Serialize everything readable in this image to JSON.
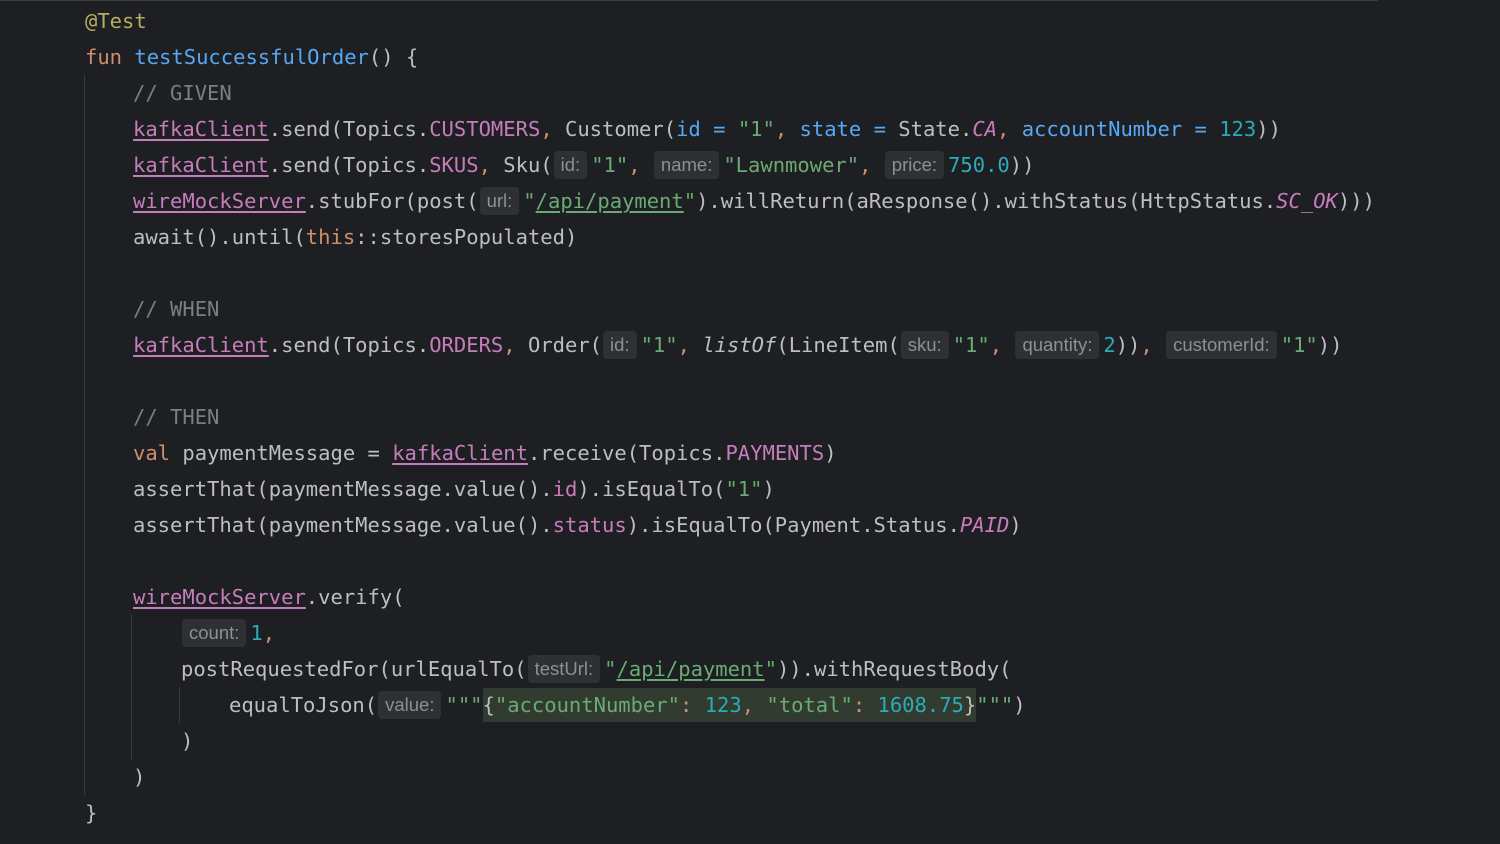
{
  "editor": {
    "lines": [
      {
        "indent": 0,
        "tokens": [
          {
            "t": "@Test",
            "c": "ann"
          }
        ]
      },
      {
        "indent": 0,
        "tokens": [
          {
            "t": "fun ",
            "c": "kw"
          },
          {
            "t": "testSuccessfulOrder",
            "c": "fn"
          },
          {
            "t": "() {",
            "c": ""
          }
        ]
      },
      {
        "indent": 1,
        "tokens": [
          {
            "t": "// GIVEN",
            "c": "cmt"
          }
        ]
      },
      {
        "indent": 1,
        "tokens": [
          {
            "t": "kafkaClient",
            "c": "prop ul"
          },
          {
            "t": ".send(Topics.",
            "c": ""
          },
          {
            "t": "CUSTOMERS",
            "c": "prop"
          },
          {
            "t": ", ",
            "c": "kw"
          },
          {
            "t": "Customer(",
            "c": ""
          },
          {
            "t": "id = ",
            "c": "named"
          },
          {
            "t": "\"1\"",
            "c": "str"
          },
          {
            "t": ", ",
            "c": "kw"
          },
          {
            "t": "state = ",
            "c": "named"
          },
          {
            "t": "State.",
            "c": ""
          },
          {
            "t": "CA",
            "c": "ital-prop"
          },
          {
            "t": ", ",
            "c": "kw"
          },
          {
            "t": "accountNumber = ",
            "c": "named"
          },
          {
            "t": "123",
            "c": "num"
          },
          {
            "t": "))",
            "c": ""
          }
        ]
      },
      {
        "indent": 1,
        "tokens": [
          {
            "t": "kafkaClient",
            "c": "prop ul"
          },
          {
            "t": ".send(Topics.",
            "c": ""
          },
          {
            "t": "SKUS",
            "c": "prop"
          },
          {
            "t": ", ",
            "c": "kw"
          },
          {
            "t": "Sku(",
            "c": ""
          },
          {
            "h": "id:"
          },
          {
            "t": "\"1\"",
            "c": "str"
          },
          {
            "t": ", ",
            "c": "kw"
          },
          {
            "h": "name:"
          },
          {
            "t": "\"Lawnmower\"",
            "c": "str"
          },
          {
            "t": ", ",
            "c": "kw"
          },
          {
            "h": "price:"
          },
          {
            "t": "750.0",
            "c": "num"
          },
          {
            "t": "))",
            "c": ""
          }
        ]
      },
      {
        "indent": 1,
        "tokens": [
          {
            "t": "wireMockServer",
            "c": "prop ul"
          },
          {
            "t": ".stubFor(post(",
            "c": ""
          },
          {
            "h": "url:"
          },
          {
            "t": "\"",
            "c": "str"
          },
          {
            "t": "/api/payment",
            "c": "str ul"
          },
          {
            "t": "\"",
            "c": "str"
          },
          {
            "t": ").willReturn(aResponse().withStatus(HttpStatus.",
            "c": ""
          },
          {
            "t": "SC_OK",
            "c": "ital-prop"
          },
          {
            "t": ")))",
            "c": ""
          }
        ]
      },
      {
        "indent": 1,
        "tokens": [
          {
            "t": "await().until(",
            "c": ""
          },
          {
            "t": "this",
            "c": "kw"
          },
          {
            "t": "::storesPopulated)",
            "c": ""
          }
        ]
      },
      {
        "indent": 1,
        "tokens": []
      },
      {
        "indent": 1,
        "tokens": [
          {
            "t": "// WHEN",
            "c": "cmt"
          }
        ]
      },
      {
        "indent": 1,
        "tokens": [
          {
            "t": "kafkaClient",
            "c": "prop ul"
          },
          {
            "t": ".send(Topics.",
            "c": ""
          },
          {
            "t": "ORDERS",
            "c": "prop"
          },
          {
            "t": ", ",
            "c": "kw"
          },
          {
            "t": "Order(",
            "c": ""
          },
          {
            "h": "id:"
          },
          {
            "t": "\"1\"",
            "c": "str"
          },
          {
            "t": ", ",
            "c": "kw"
          },
          {
            "t": "listOf",
            "c": "ital"
          },
          {
            "t": "(LineItem(",
            "c": ""
          },
          {
            "h": "sku:"
          },
          {
            "t": "\"1\"",
            "c": "str"
          },
          {
            "t": ", ",
            "c": "kw"
          },
          {
            "h": "quantity:"
          },
          {
            "t": "2",
            "c": "num"
          },
          {
            "t": "))",
            "c": ""
          },
          {
            "t": ", ",
            "c": "kw"
          },
          {
            "h": "customerId:"
          },
          {
            "t": "\"1\"",
            "c": "str"
          },
          {
            "t": "))",
            "c": ""
          }
        ]
      },
      {
        "indent": 1,
        "tokens": []
      },
      {
        "indent": 1,
        "tokens": [
          {
            "t": "// THEN",
            "c": "cmt"
          }
        ]
      },
      {
        "indent": 1,
        "tokens": [
          {
            "t": "val ",
            "c": "kw"
          },
          {
            "t": "paymentMessage = ",
            "c": ""
          },
          {
            "t": "kafkaClient",
            "c": "prop ul"
          },
          {
            "t": ".receive(Topics.",
            "c": ""
          },
          {
            "t": "PAYMENTS",
            "c": "prop"
          },
          {
            "t": ")",
            "c": ""
          }
        ]
      },
      {
        "indent": 1,
        "tokens": [
          {
            "t": "assertThat(paymentMessage.value().",
            "c": ""
          },
          {
            "t": "id",
            "c": "prop"
          },
          {
            "t": ").isEqualTo(",
            "c": ""
          },
          {
            "t": "\"1\"",
            "c": "str"
          },
          {
            "t": ")",
            "c": ""
          }
        ]
      },
      {
        "indent": 1,
        "tokens": [
          {
            "t": "assertThat(paymentMessage.value().",
            "c": ""
          },
          {
            "t": "status",
            "c": "prop"
          },
          {
            "t": ").isEqualTo(Payment.Status.",
            "c": ""
          },
          {
            "t": "PAID",
            "c": "ital-prop"
          },
          {
            "t": ")",
            "c": ""
          }
        ]
      },
      {
        "indent": 1,
        "tokens": []
      },
      {
        "indent": 1,
        "tokens": [
          {
            "t": "wireMockServer",
            "c": "prop ul"
          },
          {
            "t": ".verify(",
            "c": ""
          }
        ]
      },
      {
        "indent": 2,
        "tokens": [
          {
            "h": "count:"
          },
          {
            "t": "1",
            "c": "num"
          },
          {
            "t": ",",
            "c": "kw"
          }
        ]
      },
      {
        "indent": 2,
        "tokens": [
          {
            "t": "postRequestedFor(urlEqualTo(",
            "c": ""
          },
          {
            "h": "testUrl:"
          },
          {
            "t": "\"",
            "c": "str"
          },
          {
            "t": "/api/payment",
            "c": "str ul"
          },
          {
            "t": "\"",
            "c": "str"
          },
          {
            "t": ")).withRequestBody(",
            "c": ""
          }
        ]
      },
      {
        "indent": 3,
        "tokens": [
          {
            "t": "equalToJson(",
            "c": ""
          },
          {
            "h": "value:"
          },
          {
            "t": "\"\"\"",
            "c": "str"
          },
          {
            "inject": [
              {
                "t": "{",
                "c": ""
              },
              {
                "t": "\"accountNumber\"",
                "c": "str"
              },
              {
                "t": ": ",
                "c": "kw"
              },
              {
                "t": "123",
                "c": "num"
              },
              {
                "t": ", ",
                "c": "kw"
              },
              {
                "t": "\"total\"",
                "c": "str"
              },
              {
                "t": ": ",
                "c": "kw"
              },
              {
                "t": "1608.75",
                "c": "num"
              },
              {
                "t": "}",
                "c": ""
              }
            ]
          },
          {
            "t": "\"\"\"",
            "c": "str"
          },
          {
            "t": ")",
            "c": ""
          }
        ]
      },
      {
        "indent": 2,
        "tokens": [
          {
            "t": ")",
            "c": ""
          }
        ]
      },
      {
        "indent": 1,
        "tokens": [
          {
            "t": ")",
            "c": ""
          }
        ]
      },
      {
        "indent": 0,
        "tokens": [
          {
            "t": "}",
            "c": ""
          }
        ]
      }
    ]
  }
}
